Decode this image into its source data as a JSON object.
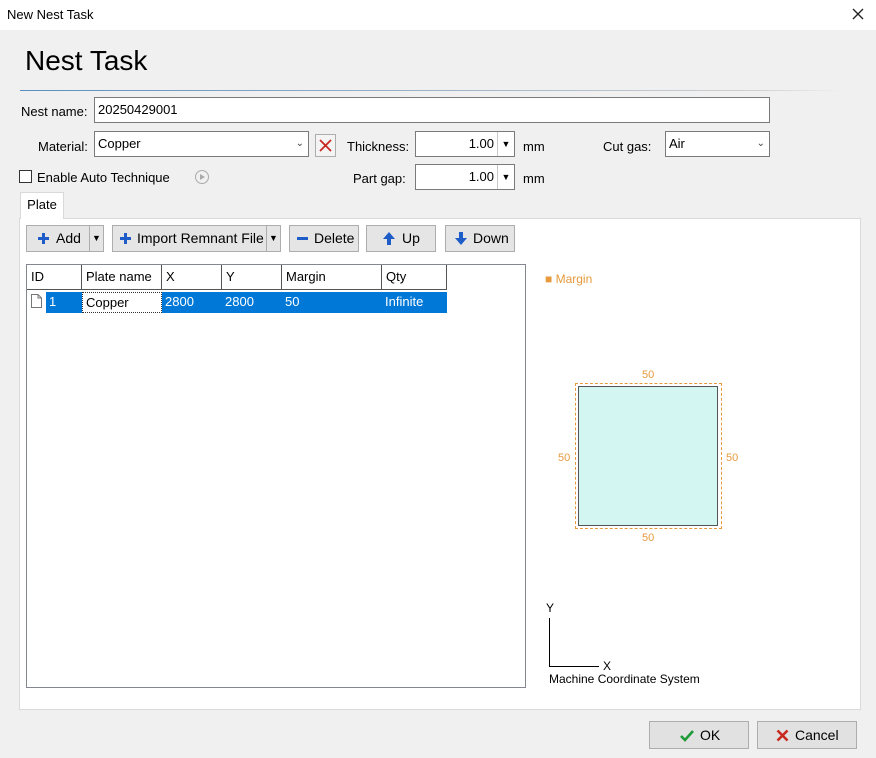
{
  "window": {
    "title": "New Nest Task"
  },
  "heading": "Nest Task",
  "nest_name": {
    "label": "Nest name:",
    "value": "20250429001"
  },
  "material": {
    "label": "Material:",
    "value": "Copper"
  },
  "thickness": {
    "label": "Thickness:",
    "value": "1.00",
    "unit": "mm"
  },
  "cut_gas": {
    "label": "Cut gas:",
    "value": "Air"
  },
  "auto_technique": {
    "label": "Enable Auto Technique",
    "checked": false
  },
  "part_gap": {
    "label": "Part gap:",
    "value": "1.00",
    "unit": "mm"
  },
  "tabs": [
    {
      "label": "Plate"
    }
  ],
  "toolbar": {
    "add": "Add",
    "import": "Import Remnant File",
    "delete": "Delete",
    "up": "Up",
    "down": "Down"
  },
  "table": {
    "columns": [
      "ID",
      "Plate name",
      "X",
      "Y",
      "Margin",
      "Qty"
    ],
    "rows": [
      {
        "id": "1",
        "name": "Copper",
        "x": "2800",
        "y": "2800",
        "margin": "50",
        "qty": "Infinite"
      }
    ]
  },
  "preview": {
    "legend": "Margin",
    "margin_top": "50",
    "margin_left": "50",
    "margin_right": "50",
    "margin_bottom": "50",
    "axis_y": "Y",
    "axis_x": "X",
    "coord_caption": "Machine Coordinate System"
  },
  "buttons": {
    "ok": "OK",
    "cancel": "Cancel"
  },
  "colors": {
    "accent": "#0078d7",
    "margin": "#e69a3c",
    "plate_fill": "#d4f6f2",
    "delete_red": "#c8281e",
    "ok_green": "#1e9b37",
    "arrow_blue": "#1e5cc8"
  }
}
